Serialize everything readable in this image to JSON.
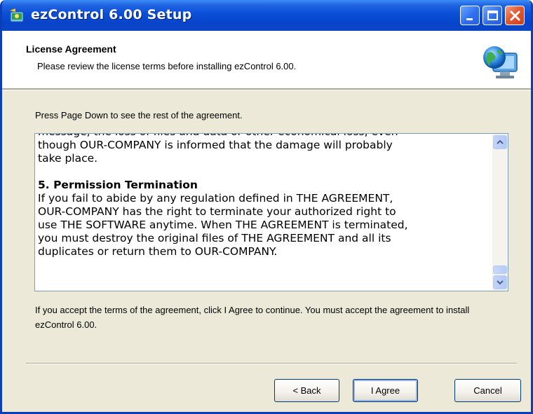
{
  "window": {
    "title": "ezControl 6.00 Setup",
    "icon": "installer-app-icon",
    "controls": [
      "minimize-icon",
      "maximize-icon",
      "close-icon"
    ]
  },
  "header": {
    "title": "License Agreement",
    "subtitle": "Please review the license terms before installing ezControl 6.00.",
    "icon": "globe-computer-icon"
  },
  "body": {
    "instruction": "Press Page Down to see the rest of the agreement.",
    "license_lines": {
      "cut_line": "message, the loss of files and data or other economical loss, even",
      "p1": "though OUR-COMPANY is informed that the damage will probably\ntake place.",
      "section_heading": "5. Permission Termination",
      "section_body": "If you fail to abide by any regulation defined in THE AGREEMENT,\nOUR-COMPANY has the right to terminate your authorized right to\nuse THE SOFTWARE anytime. When THE AGREEMENT is terminated,\nyou must destroy the original files of THE AGREEMENT and all its\nduplicates or return them to OUR-COMPANY."
    },
    "scroll_position": 0.95,
    "accept_note": "If you accept the terms of the agreement, click I Agree to continue. You must accept the agreement to install ezControl 6.00."
  },
  "buttons": {
    "back": "< Back",
    "agree": "I Agree",
    "cancel": "Cancel"
  },
  "colors": {
    "titlebar": "#0a4ed8",
    "dialog_bg": "#ece9d8",
    "button_border": "#003c74"
  }
}
